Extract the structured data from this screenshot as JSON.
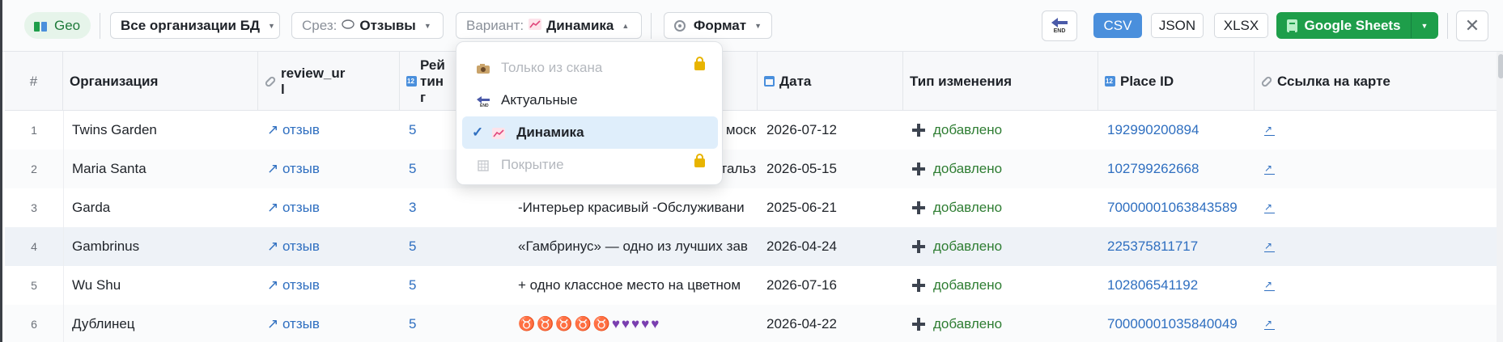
{
  "toolbar": {
    "geo_label": "Geo",
    "org_label": "Все организации БД",
    "slice_prefix": "Срез:",
    "slice_value": "Отзывы",
    "variant_prefix": "Вариант:",
    "variant_value": "Динамика",
    "format_label": "Формат",
    "end_label": "END",
    "csv_label": "CSV",
    "json_label": "JSON",
    "xlsx_label": "XLSX",
    "gsheets_label": "Google Sheets",
    "close_icon": "✕"
  },
  "variant_menu": {
    "items": [
      {
        "label": "Только из скана",
        "icon": "camera-icon",
        "disabled": true,
        "locked": true
      },
      {
        "label": "Актуальные",
        "icon": "end-arrow-icon",
        "disabled": false,
        "locked": false
      },
      {
        "label": "Динамика",
        "icon": "trend-chart-icon",
        "disabled": false,
        "locked": false,
        "selected": true
      },
      {
        "label": "Покрытие",
        "icon": "grid-icon",
        "disabled": true,
        "locked": true
      }
    ],
    "check_mark": "✓"
  },
  "table": {
    "headers": {
      "num": "#",
      "org": "Организация",
      "review_url": "review_ur\nl",
      "rating": "Рей\nтин\nг",
      "date": "Дата",
      "change_type": "Тип изменения",
      "place_id": "Place ID",
      "map_link": "Ссылка на карте"
    },
    "rows": [
      {
        "n": "1",
        "org": "Twins Garden",
        "review": "↗ отзыв",
        "rating": "5",
        "text": "моск",
        "date": "2026-07-12",
        "change": "добавлено",
        "place_id": "192990200894"
      },
      {
        "n": "2",
        "org": "Maria Santa",
        "review": "↗ отзыв",
        "rating": "5",
        "text": "тальз",
        "date": "2026-05-15",
        "change": "добавлено",
        "place_id": "102799262668"
      },
      {
        "n": "3",
        "org": "Garda",
        "review": "↗ отзыв",
        "rating": "3",
        "text": "-Интерьер красивый -Обслуживани",
        "date": "2025-06-21",
        "change": "добавлено",
        "place_id": "70000001063843589"
      },
      {
        "n": "4",
        "org": "Gambrinus",
        "review": "↗ отзыв",
        "rating": "5",
        "text": "«Гамбринус» — одно из лучших зав",
        "date": "2026-04-24",
        "change": "добавлено",
        "place_id": "225375811717"
      },
      {
        "n": "5",
        "org": "Wu Shu",
        "review": "↗ отзыв",
        "rating": "5",
        "text": "+ одно классное место на цветном",
        "date": "2026-07-16",
        "change": "добавлено",
        "place_id": "102806541192"
      },
      {
        "n": "6",
        "org": "Дублинец",
        "review": "↗ отзыв",
        "rating": "5",
        "text": "♉♉♉♉♉♥♥♥♥♥",
        "date": "2026-04-22",
        "change": "добавлено",
        "place_id": "70000001035840049"
      }
    ]
  },
  "colors": {
    "accent": "#4a8fdc",
    "green": "#1e9e4a",
    "link": "#2f6fc0",
    "added": "#2e7d32"
  }
}
